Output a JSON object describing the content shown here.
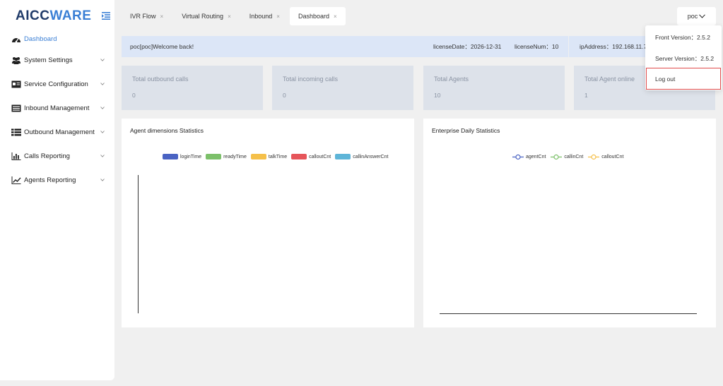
{
  "app": {
    "logo_part1": "AICC",
    "logo_part2": "WARE"
  },
  "sidebar": {
    "items": [
      {
        "label": "Dashboard",
        "icon": "dashboard-icon"
      },
      {
        "label": "System Settings",
        "icon": "users-icon"
      },
      {
        "label": "Service Configuration",
        "icon": "id-card-icon"
      },
      {
        "label": "Inbound Management",
        "icon": "list-icon"
      },
      {
        "label": "Outbound Management",
        "icon": "grid-list-icon"
      },
      {
        "label": "Calls Reporting",
        "icon": "bar-chart-icon"
      },
      {
        "label": "Agents Reporting",
        "icon": "line-chart-icon"
      }
    ]
  },
  "tabs": [
    {
      "label": "IVR Flow",
      "close": "×"
    },
    {
      "label": "Virtual Routing",
      "close": "×"
    },
    {
      "label": "Inbound",
      "close": "×"
    },
    {
      "label": "Dashboard",
      "close": "×"
    }
  ],
  "user": {
    "name": "poc"
  },
  "welcome": {
    "message": "poc[poc]Welcome back!",
    "license_date": "licenseDate：2026-12-31",
    "license_num": "licenseNum：10",
    "ip_address": "ipAddress：192.168.11.7"
  },
  "stats": [
    {
      "title": "Total outbound calls",
      "value": "0"
    },
    {
      "title": "Total incoming calls",
      "value": "0"
    },
    {
      "title": "Total Agents",
      "value": "10"
    },
    {
      "title": "Total Agent online",
      "value": "1"
    }
  ],
  "dropdown": {
    "front_version": "Front Version：2.5.2",
    "server_version": "Server Version：2.5.2",
    "logout": "Log out"
  },
  "colors": {
    "accent": "#3a7fd5",
    "welcome_bg": "#dce6f7",
    "card_bg": "#dde2ea",
    "logout_border": "#e04a4a"
  },
  "chart_data": [
    {
      "type": "bar",
      "title": "Agent dimensions Statistics",
      "categories": [],
      "series": [
        {
          "name": "loginTime",
          "color": "#4a63c3",
          "values": []
        },
        {
          "name": "readyTime",
          "color": "#7cc06a",
          "values": []
        },
        {
          "name": "talkTime",
          "color": "#f5c04a",
          "values": []
        },
        {
          "name": "calloutCnt",
          "color": "#e6555a",
          "values": []
        },
        {
          "name": "callinAnswerCnt",
          "color": "#5eb5d8",
          "values": []
        }
      ],
      "legend": "top-center"
    },
    {
      "type": "line",
      "title": "Enterprise Daily Statistics",
      "x": [],
      "series": [
        {
          "name": "agentCnt",
          "color": "#4a63c3",
          "values": []
        },
        {
          "name": "callinCnt",
          "color": "#7cc06a",
          "values": []
        },
        {
          "name": "calloutCnt",
          "color": "#f5c04a",
          "values": []
        }
      ],
      "legend": "top-center"
    }
  ]
}
